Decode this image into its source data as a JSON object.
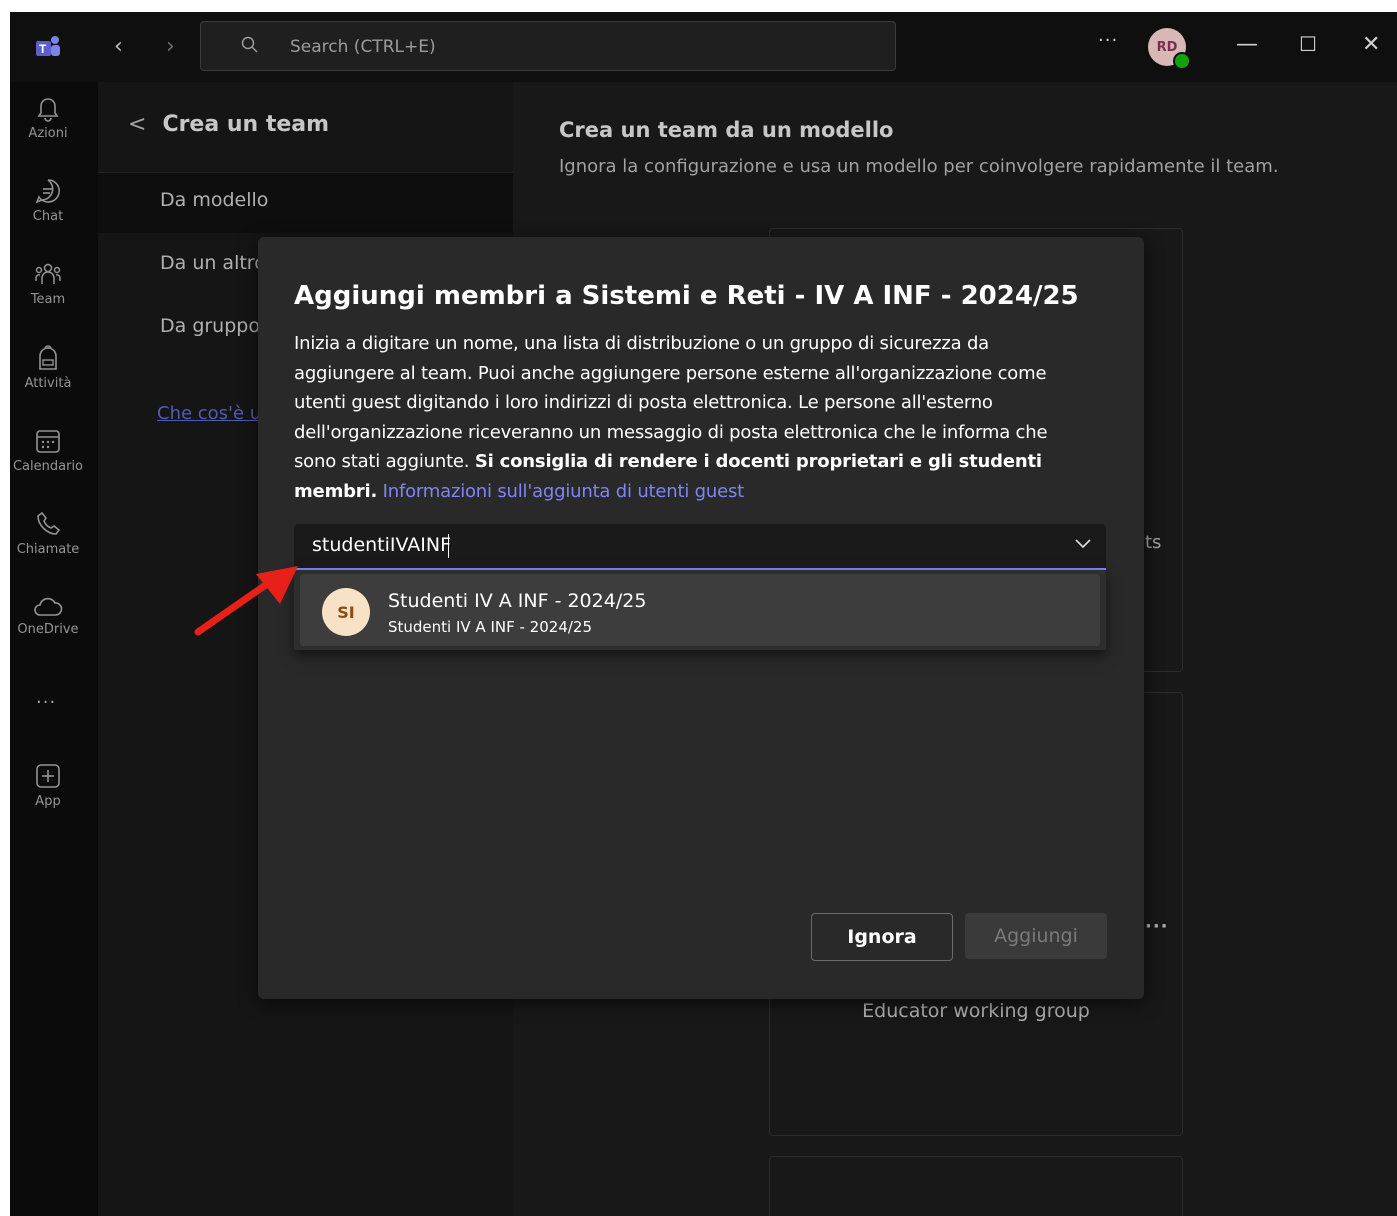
{
  "titlebar": {
    "search_placeholder": "Search (CTRL+E)",
    "more_label": "···",
    "avatar_initials": "RD",
    "minimize_label": "—",
    "maximize_label": "☐",
    "close_label": "✕"
  },
  "rail": {
    "items": [
      {
        "label": "Azioni",
        "icon": "bell-icon"
      },
      {
        "label": "Chat",
        "icon": "chat-icon"
      },
      {
        "label": "Team",
        "icon": "team-icon"
      },
      {
        "label": "Attività",
        "icon": "backpack-icon"
      },
      {
        "label": "Calendario",
        "icon": "calendar-icon"
      },
      {
        "label": "Chiamate",
        "icon": "phone-icon"
      },
      {
        "label": "OneDrive",
        "icon": "cloud-icon"
      },
      {
        "label": "App",
        "icon": "add-app-icon"
      }
    ],
    "more_label": "···"
  },
  "left_pane": {
    "back_label": "<",
    "title": "Crea un team",
    "items": [
      "Da modello",
      "Da un altro",
      "Da gruppo"
    ],
    "selected_index": 0,
    "help_link": "Che cos'è u"
  },
  "main": {
    "title": "Crea un team da un modello",
    "subtitle": "Ignora la configurazione e usa un modello per coinvolgere rapidamente il team.",
    "card_partial_text": "ts",
    "card_more_label": "···",
    "card_name": "Educator working group"
  },
  "dialog": {
    "title": "Aggiungi membri a Sistemi e Reti - IV A INF - 2024/25",
    "body_text": "Inizia a digitare un nome, una lista di distribuzione o un gruppo di sicurezza da aggiungere al team. Puoi anche aggiungere persone esterne all'organizzazione come utenti guest digitando i loro indirizzi di posta elettronica. Le persone all'esterno dell'organizzazione riceveranno un messaggio di posta elettronica che le informa che sono stati aggiunte.",
    "body_bold": "Si consiglia di rendere i docenti proprietari e gli studenti membri.",
    "body_link": "Informazioni sull'aggiunta di utenti guest",
    "picker_value": "studentiIVAINF",
    "suggestion": {
      "initials": "SI",
      "name": "Studenti IV A INF - 2024/25",
      "detail": "Studenti IV A INF - 2024/25"
    },
    "ignore_button": "Ignora",
    "add_button": "Aggiungi"
  },
  "annotation": {
    "color": "#e8201a"
  }
}
